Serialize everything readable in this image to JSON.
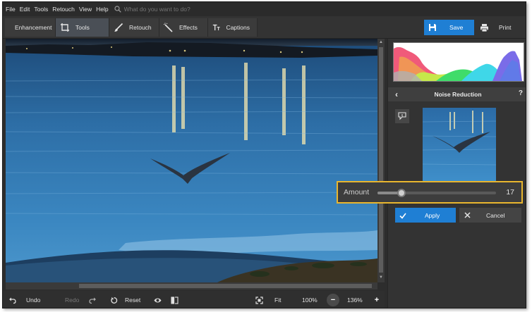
{
  "menu": [
    "File",
    "Edit",
    "Tools",
    "Retouch",
    "View",
    "Help"
  ],
  "search": {
    "placeholder": "What do you want to do?"
  },
  "tabs": [
    {
      "label": "Enhancement",
      "icon": "sliders-icon"
    },
    {
      "label": "Tools",
      "icon": "crop-icon"
    },
    {
      "label": "Retouch",
      "icon": "brush-icon"
    },
    {
      "label": "Effects",
      "icon": "magic-wand-icon"
    },
    {
      "label": "Captions",
      "icon": "text-icon"
    }
  ],
  "active_tab": "Tools",
  "toolbar": {
    "save_label": "Save",
    "print_label": "Print"
  },
  "panel": {
    "title": "Noise Reduction",
    "help": "?",
    "amount_label": "Amount",
    "amount_value": "17",
    "amount_fraction": 0.2,
    "apply_label": "Apply",
    "cancel_label": "Cancel"
  },
  "bottom": {
    "undo_label": "Undo",
    "redo_label": "Redo",
    "reset_label": "Reset",
    "fit_label": "Fit",
    "zoom_100": "100%",
    "zoom_current": "136%",
    "zoom_out": "−",
    "zoom_in": "+"
  },
  "colors": {
    "accent": "#1f7fd4",
    "highlight": "#e9b62e",
    "background": "#2d2d2d"
  }
}
